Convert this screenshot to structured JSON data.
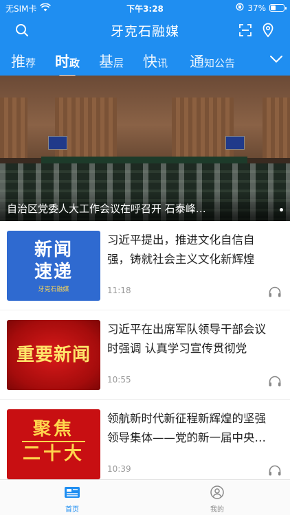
{
  "status_bar": {
    "carrier": "无SIM卡",
    "time": "下午3:28",
    "battery_text": "37%",
    "battery_level": 0.37
  },
  "app": {
    "title": "牙克石融媒"
  },
  "tabs": [
    {
      "big": "推",
      "small": "荐",
      "active": false
    },
    {
      "big": "时",
      "small": "政",
      "active": true
    },
    {
      "big": "基",
      "small": "层",
      "active": false
    },
    {
      "big": "快",
      "small": "讯",
      "active": false
    },
    {
      "big": "通",
      "small": "知公告",
      "active": false
    }
  ],
  "hero": {
    "caption": "自治区党委人大工作会议在呼召开 石泰峰…"
  },
  "news": [
    {
      "title": "习近平提出，推进文化自信自强，铸就社会主义文化新辉煌",
      "time": "11:18",
      "thumb": {
        "line1": "新闻",
        "line2": "速递",
        "logo": "牙克石融媒"
      }
    },
    {
      "title": "习近平在出席军队领导干部会议时强调 认真学习宣传贯彻党的…",
      "time": "10:55",
      "thumb": {
        "text": "重要新闻"
      }
    },
    {
      "title": "领航新时代新征程新辉煌的坚强领导集体——党的新一届中央…",
      "time": "10:39",
      "thumb": {
        "line1": "聚焦",
        "line2": "二十大"
      }
    }
  ],
  "tabbar": {
    "home_label": "首页",
    "mine_label": "我的"
  },
  "colors": {
    "brand_blue": "#1f8ef1",
    "text_dark": "#222222",
    "text_muted": "#999999"
  }
}
